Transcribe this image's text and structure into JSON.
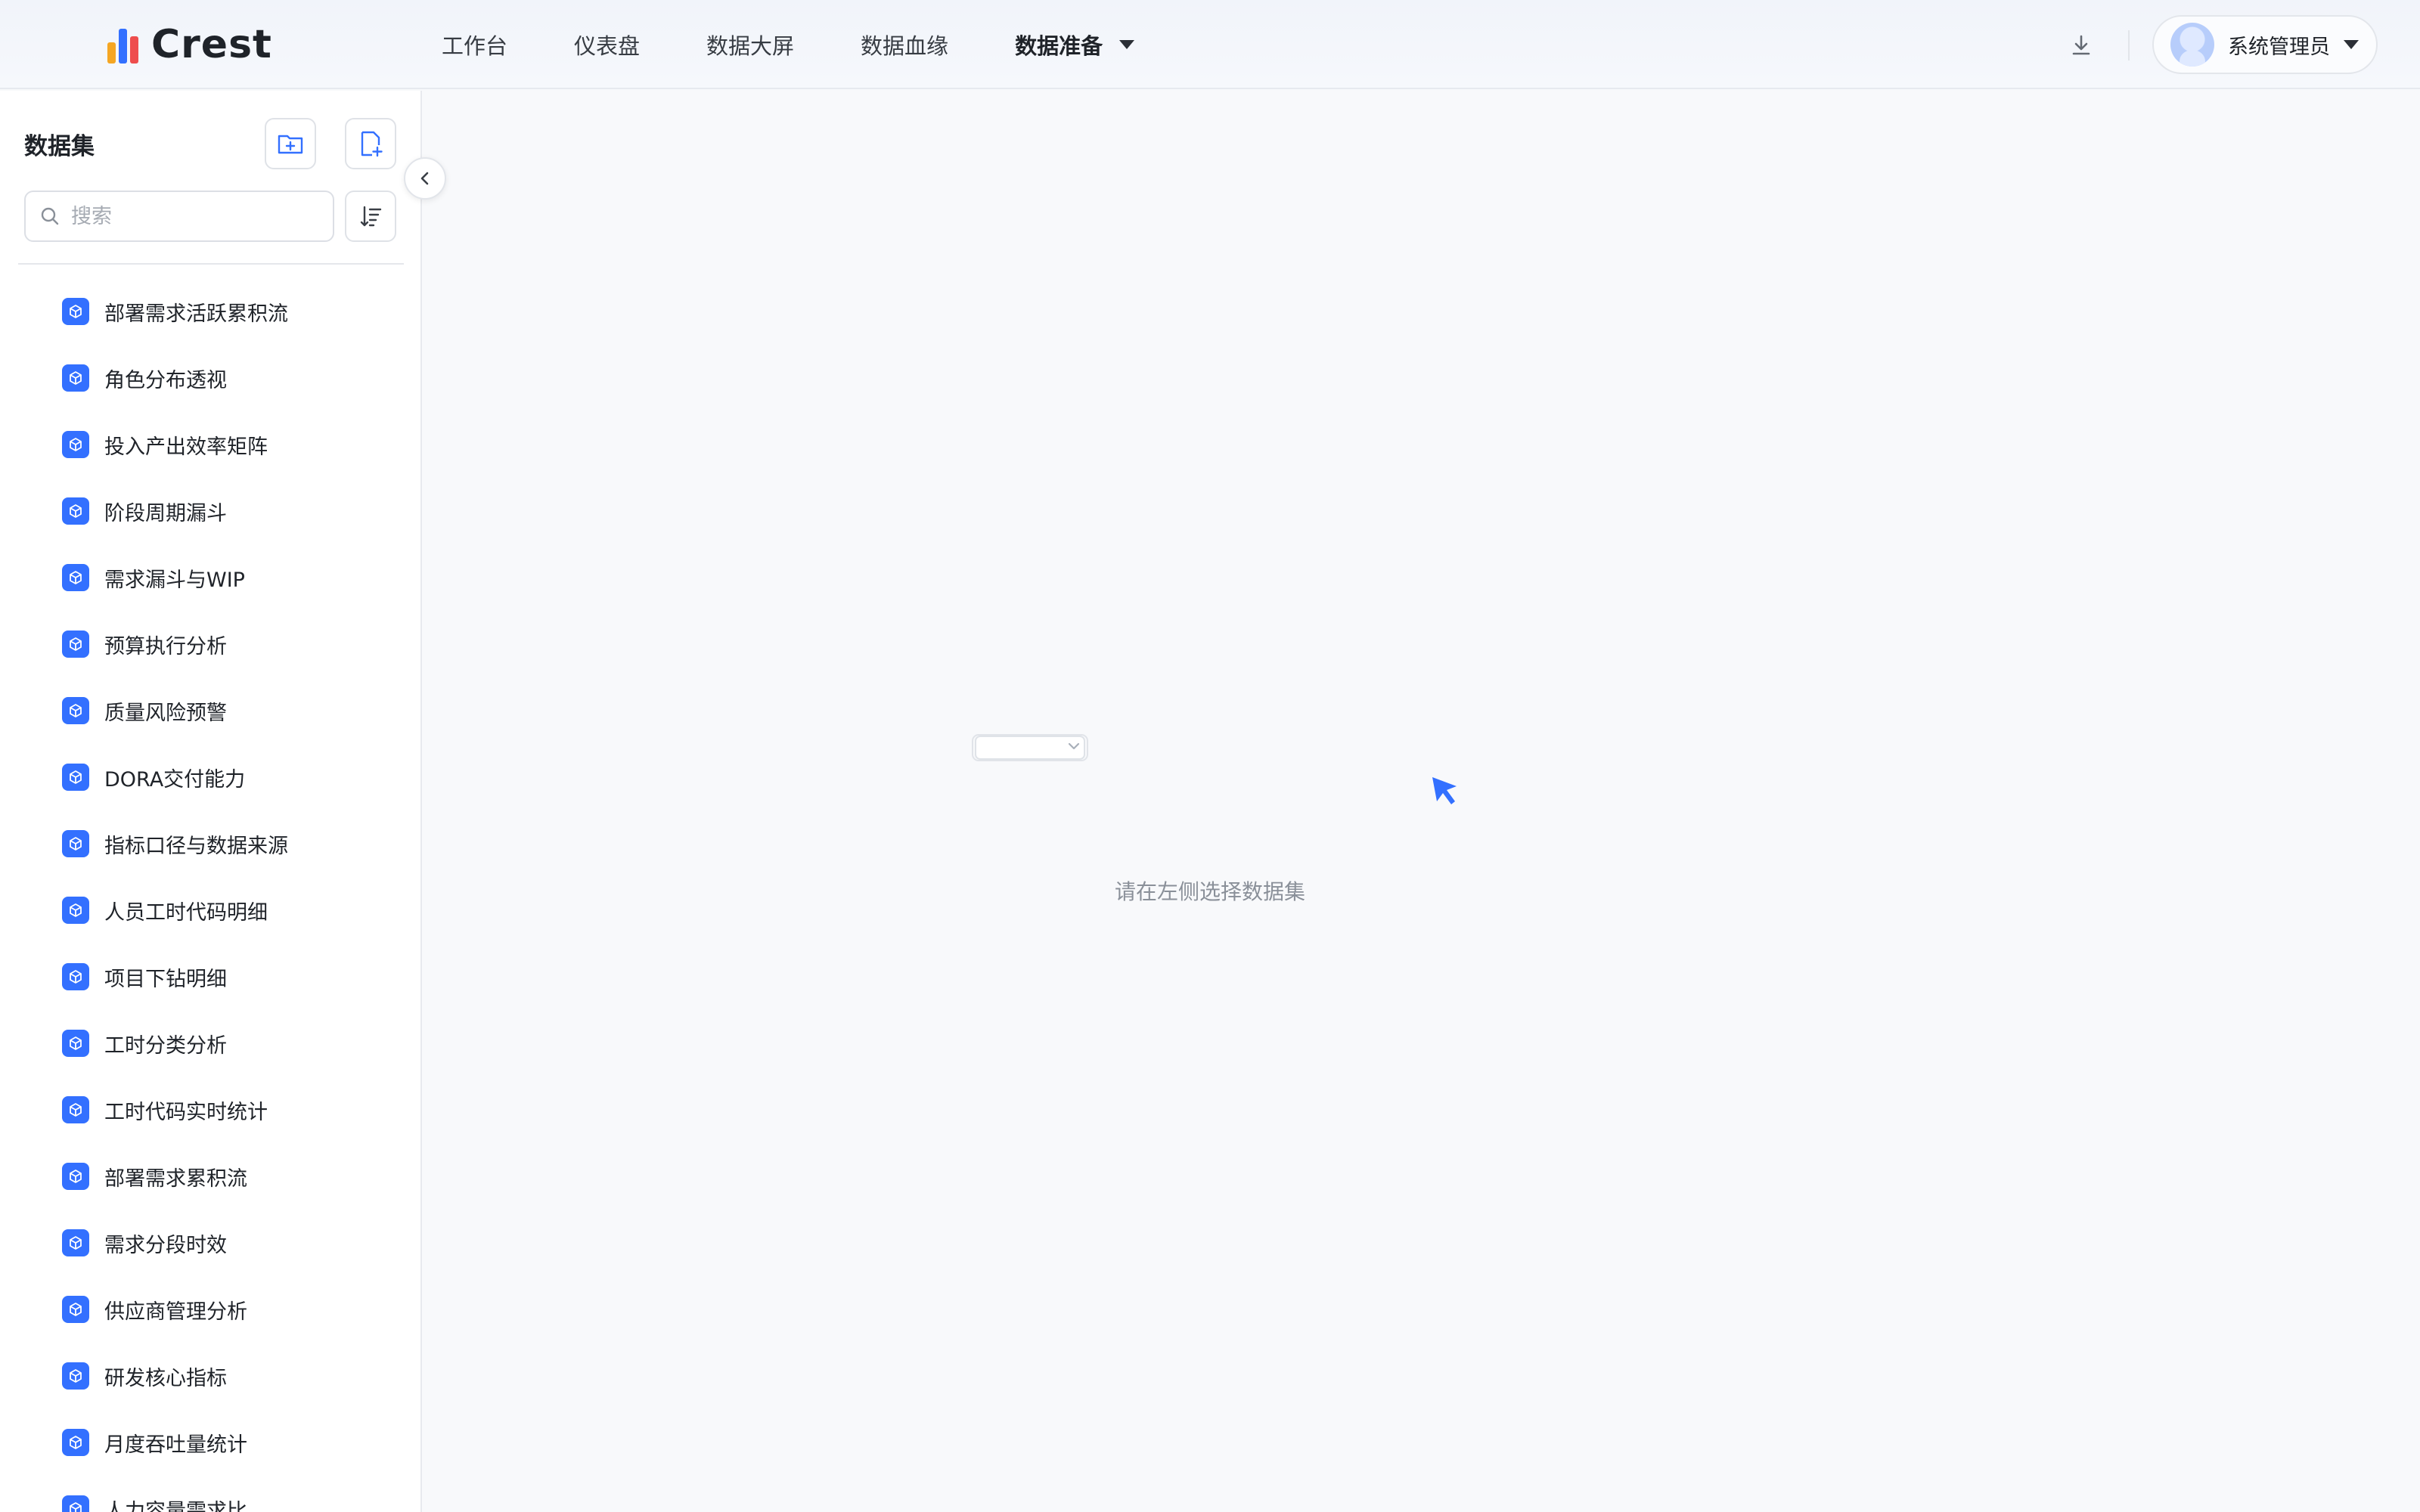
{
  "brand": {
    "name": "Crest"
  },
  "nav": {
    "items": [
      {
        "label": "工作台"
      },
      {
        "label": "仪表盘"
      },
      {
        "label": "数据大屏"
      },
      {
        "label": "数据血缘"
      },
      {
        "label": "数据准备",
        "active": true
      }
    ]
  },
  "user": {
    "name": "系统管理员"
  },
  "sidebar": {
    "title": "数据集",
    "search_placeholder": "搜索",
    "items": [
      {
        "label": "部署需求活跃累积流"
      },
      {
        "label": "角色分布透视"
      },
      {
        "label": "投入产出效率矩阵"
      },
      {
        "label": "阶段周期漏斗"
      },
      {
        "label": "需求漏斗与WIP"
      },
      {
        "label": "预算执行分析"
      },
      {
        "label": "质量风险预警"
      },
      {
        "label": "DORA交付能力"
      },
      {
        "label": "指标口径与数据来源"
      },
      {
        "label": "人员工时代码明细"
      },
      {
        "label": "项目下钻明细"
      },
      {
        "label": "工时分类分析"
      },
      {
        "label": "工时代码实时统计"
      },
      {
        "label": "部署需求累积流"
      },
      {
        "label": "需求分段时效"
      },
      {
        "label": "供应商管理分析"
      },
      {
        "label": "研发核心指标"
      },
      {
        "label": "月度吞吐量统计"
      },
      {
        "label": "人力容量需求比"
      }
    ]
  },
  "main": {
    "empty_text": "请在左侧选择数据集"
  },
  "colors": {
    "accent": "#3370ff",
    "text": "#1f2329",
    "muted": "#8a9099"
  }
}
